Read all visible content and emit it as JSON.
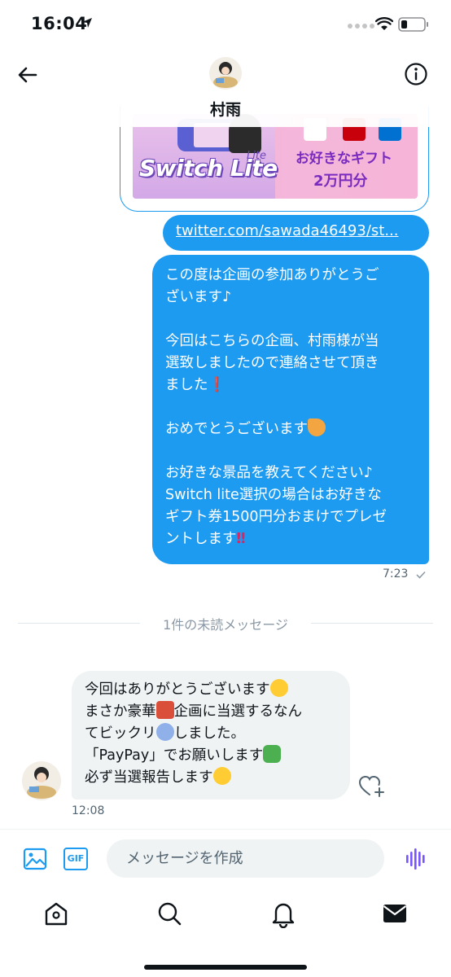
{
  "status_bar": {
    "time": "16:04",
    "icons": [
      "location-arrow-icon",
      "signal-icon",
      "wifi-icon",
      "battery-icon"
    ]
  },
  "header": {
    "name": "村雨",
    "back_icon": "arrow-left-icon",
    "info_icon": "info-circle-icon"
  },
  "card": {
    "banner": {
      "title": "Switch Lite",
      "subtitle": "Lite",
      "gift_line1": "お好きなギフト",
      "gift_line2": "2万円分"
    }
  },
  "link": {
    "text": "twitter.com/sawada46493/st..."
  },
  "sent_message": {
    "lines_1": [
      "この度は企画の参加ありがとうご",
      "ざいます♪"
    ],
    "lines_2": [
      "今回はこちらの企画、村雨様が当",
      "選致しましたので連絡させて頂き",
      "ました"
    ],
    "line_3": "おめでとうございます",
    "lines_4": [
      "お好きな景品を教えてください♪",
      "Switch lite選択の場合はお好きな",
      "ギフト券1500円分おまけでプレゼ",
      "ントします"
    ],
    "time": "7:23"
  },
  "unread_divider": {
    "text": "1件の未読メッセージ"
  },
  "received_message": {
    "line_1": "今回はありがとうございます",
    "line_2a": "まさか豪華",
    "line_2b": "企画に当選するなん",
    "line_3a": "てビックリ",
    "line_3b": "しました。",
    "line_4": "「PayPay」でお願いします",
    "line_5": "必ず当選報告します",
    "time": "12:08"
  },
  "composer": {
    "placeholder": "メッセージを作成",
    "gif_label": "GIF"
  },
  "tabs": [
    "home-icon",
    "search-icon",
    "notifications-icon",
    "messages-icon"
  ],
  "colors": {
    "accent": "#1d9bf0",
    "received_bubble": "#eff3f4",
    "voice": "#7856ff"
  }
}
